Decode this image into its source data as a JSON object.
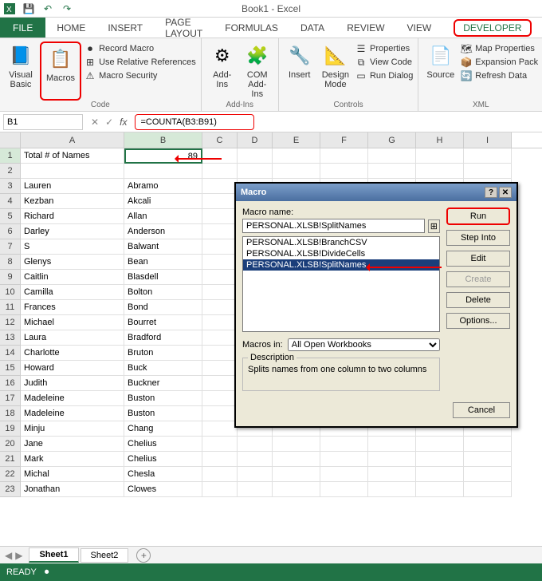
{
  "app": {
    "title": "Book1 - Excel"
  },
  "tabs": {
    "file": "FILE",
    "home": "HOME",
    "insert": "INSERT",
    "page_layout": "PAGE LAYOUT",
    "formulas": "FORMULAS",
    "data": "DATA",
    "review": "REVIEW",
    "view": "VIEW",
    "developer": "DEVELOPER"
  },
  "ribbon": {
    "code": {
      "label": "Code",
      "visual_basic": "Visual\nBasic",
      "macros": "Macros",
      "record_macro": "Record Macro",
      "use_rel_refs": "Use Relative References",
      "macro_security": "Macro Security"
    },
    "addins": {
      "label": "Add-Ins",
      "addins": "Add-Ins",
      "com_addins": "COM\nAdd-Ins"
    },
    "controls": {
      "label": "Controls",
      "insert": "Insert",
      "design_mode": "Design\nMode",
      "properties": "Properties",
      "view_code": "View Code",
      "run_dialog": "Run Dialog"
    },
    "xml": {
      "label": "XML",
      "source": "Source",
      "map_props": "Map Properties",
      "expansion": "Expansion Pack",
      "refresh": "Refresh Data"
    }
  },
  "namebox": "B1",
  "formula": "=COUNTA(B3:B91)",
  "columns": [
    "A",
    "B",
    "C",
    "D",
    "E",
    "F",
    "G",
    "H",
    "I"
  ],
  "rows": [
    {
      "n": 1,
      "a": "Total # of Names",
      "b": "89",
      "sel": true
    },
    {
      "n": 2,
      "a": "",
      "b": ""
    },
    {
      "n": 3,
      "a": "Lauren",
      "b": "Abramo"
    },
    {
      "n": 4,
      "a": "Kezban",
      "b": "Akcali"
    },
    {
      "n": 5,
      "a": "Richard",
      "b": "Allan"
    },
    {
      "n": 6,
      "a": "Darley",
      "b": "Anderson"
    },
    {
      "n": 7,
      "a": "S",
      "b": "Balwant"
    },
    {
      "n": 8,
      "a": "Glenys",
      "b": "Bean"
    },
    {
      "n": 9,
      "a": "Caitlin",
      "b": "Blasdell"
    },
    {
      "n": 10,
      "a": "Camilla",
      "b": "Bolton"
    },
    {
      "n": 11,
      "a": "Frances",
      "b": "Bond"
    },
    {
      "n": 12,
      "a": "Michael",
      "b": "Bourret"
    },
    {
      "n": 13,
      "a": "Laura",
      "b": "Bradford"
    },
    {
      "n": 14,
      "a": "Charlotte",
      "b": "Bruton"
    },
    {
      "n": 15,
      "a": "Howard",
      "b": "Buck"
    },
    {
      "n": 16,
      "a": "Judith",
      "b": "Buckner"
    },
    {
      "n": 17,
      "a": "Madeleine",
      "b": "Buston"
    },
    {
      "n": 18,
      "a": "Madeleine",
      "b": "Buston"
    },
    {
      "n": 19,
      "a": "Minju",
      "b": "Chang"
    },
    {
      "n": 20,
      "a": "Jane",
      "b": "Chelius"
    },
    {
      "n": 21,
      "a": "Mark",
      "b": "Chelius"
    },
    {
      "n": 22,
      "a": "Michal",
      "b": "Chesla"
    },
    {
      "n": 23,
      "a": "Jonathan",
      "b": "Clowes"
    }
  ],
  "macro_dialog": {
    "title": "Macro",
    "name_label": "Macro name:",
    "name_value": "PERSONAL.XLSB!SplitNames",
    "list": [
      "PERSONAL.XLSB!BranchCSV",
      "PERSONAL.XLSB!DivideCells",
      "PERSONAL.XLSB!SplitNames"
    ],
    "selected_index": 2,
    "macros_in_label": "Macros in:",
    "macros_in_value": "All Open Workbooks",
    "desc_label": "Description",
    "desc_text": "Splits names from one column to two columns",
    "btn_run": "Run",
    "btn_step": "Step Into",
    "btn_edit": "Edit",
    "btn_create": "Create",
    "btn_delete": "Delete",
    "btn_options": "Options...",
    "btn_cancel": "Cancel"
  },
  "sheets": {
    "s1": "Sheet1",
    "s2": "Sheet2"
  },
  "status": "READY"
}
